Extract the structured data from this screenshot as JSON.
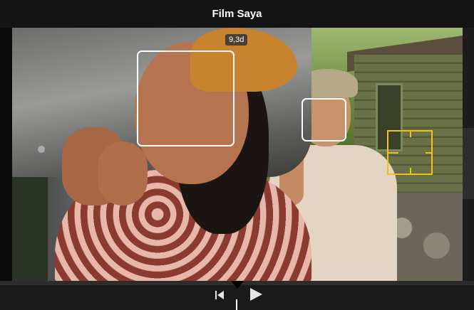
{
  "window": {
    "title": "Film Saya"
  },
  "viewer": {
    "timestamp": "9,3d",
    "colors": {
      "tracker": "#ffffff",
      "focus": "#f2c21b"
    },
    "icons": [
      "face-tracker-box",
      "focus-reticle-icon"
    ]
  },
  "controls": {
    "skip_back_icon": "skip-to-start-icon",
    "play_icon": "play-icon"
  }
}
